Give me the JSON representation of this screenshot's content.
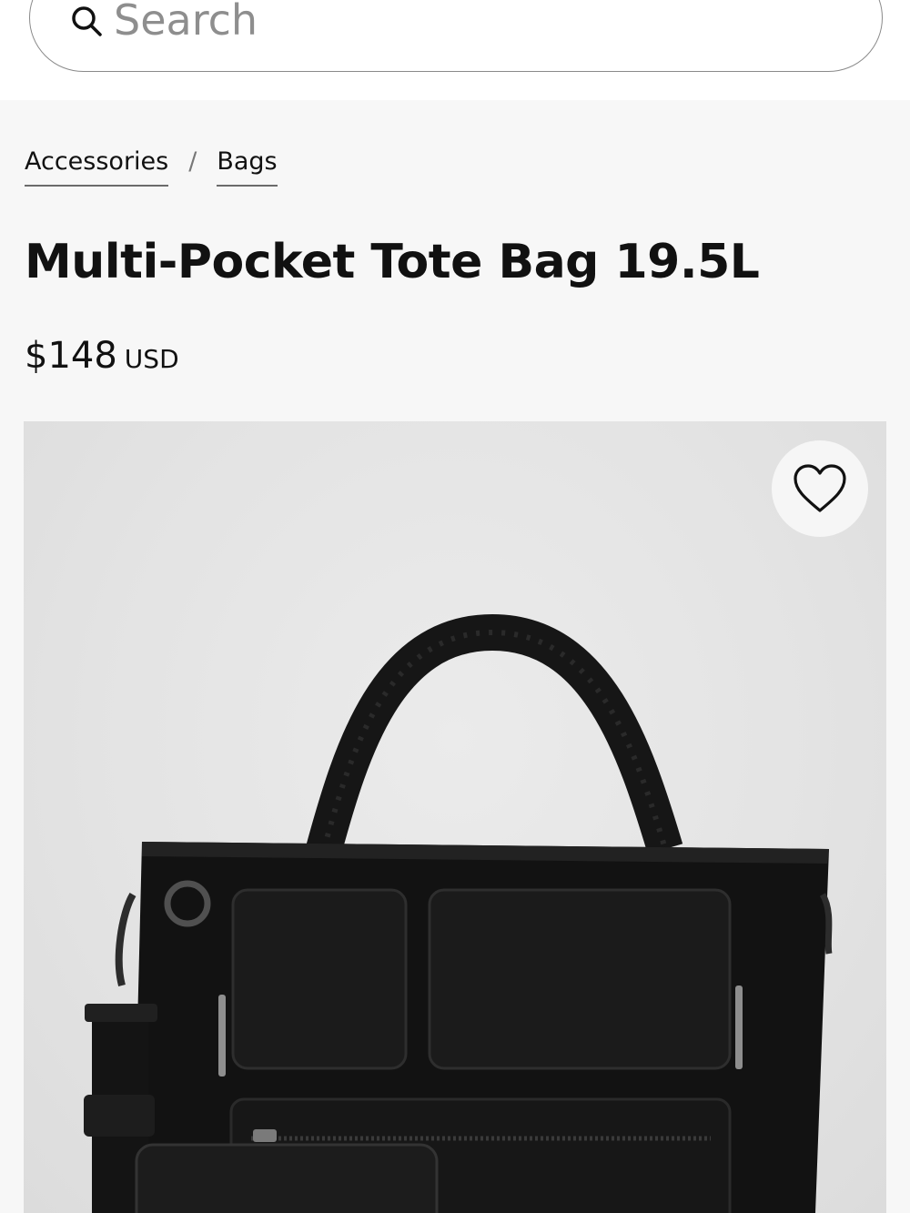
{
  "search": {
    "placeholder": "Search"
  },
  "breadcrumb": [
    {
      "label": "Accessories"
    },
    {
      "label": "Bags"
    }
  ],
  "breadcrumb_separator": "/",
  "product": {
    "title": "Multi-Pocket Tote Bag 19.5L",
    "price": "$148",
    "currency": "USD",
    "image_alt": "black tote bag with multiple front pockets"
  },
  "icons": {
    "search": "search-icon",
    "wishlist": "heart-icon"
  },
  "colors": {
    "page_background": "#f7f7f7",
    "text": "#111111",
    "search_border": "#8a8a8a",
    "placeholder": "#8e8e8e"
  }
}
